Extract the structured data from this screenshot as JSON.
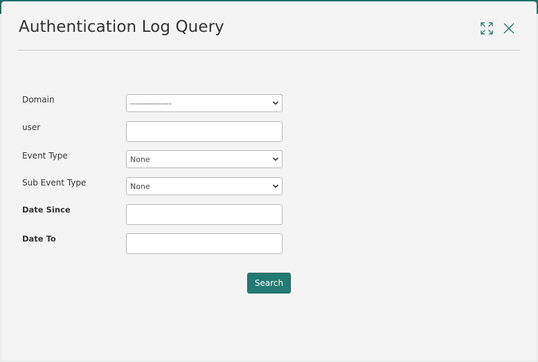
{
  "modal": {
    "title": "Authentication Log Query"
  },
  "icons": {
    "expand": "expand-icon",
    "close": "close-icon",
    "chevron": "chevron-down-icon"
  },
  "form": {
    "domain": {
      "label": "Domain",
      "value": "---------------"
    },
    "user": {
      "label": "user",
      "value": "",
      "placeholder": ""
    },
    "event_type": {
      "label": "Event Type",
      "value": "None"
    },
    "sub_event_type": {
      "label": "Sub Event Type",
      "value": "None"
    },
    "date_since": {
      "label": "Date Since",
      "value": "",
      "placeholder": ""
    },
    "date_to": {
      "label": "Date To",
      "value": "",
      "placeholder": ""
    }
  },
  "actions": {
    "search_label": "Search"
  },
  "colors": {
    "accent": "#237a73",
    "title_text": "#333333",
    "modal_bg": "#f4f4f4"
  }
}
